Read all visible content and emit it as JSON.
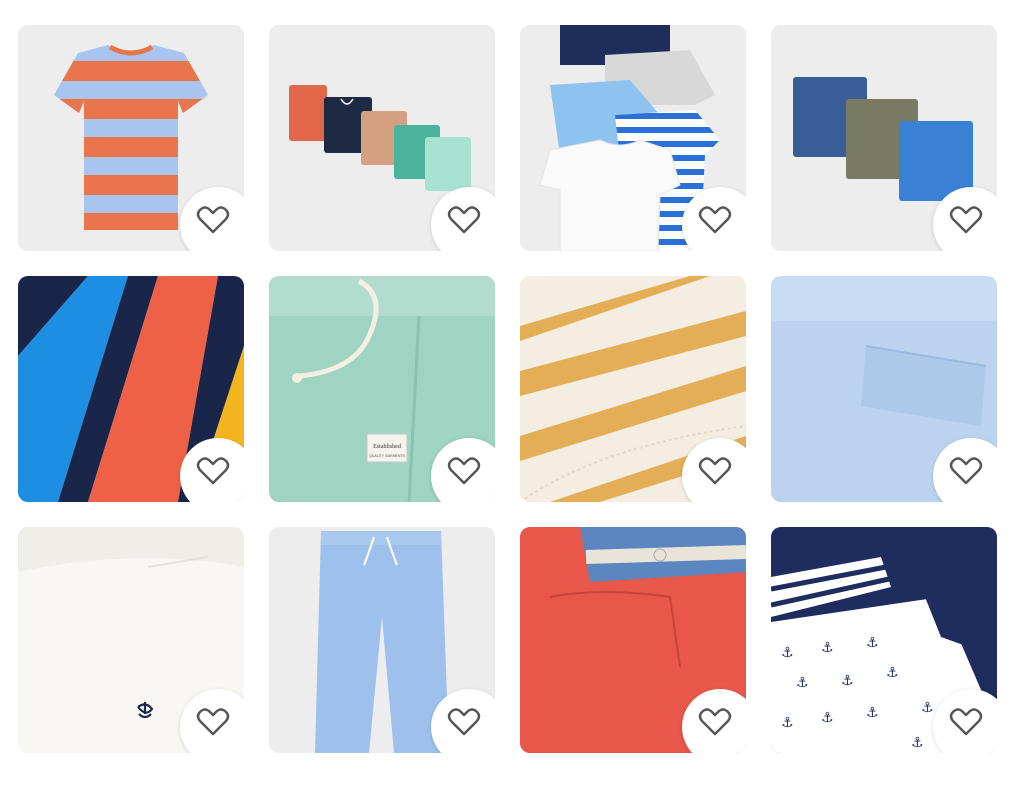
{
  "products": [
    {
      "name": "striped-tshirt",
      "icon": "heart-icon"
    },
    {
      "name": "five-pack-shorts",
      "icon": "heart-icon"
    },
    {
      "name": "five-pack-tshirts",
      "icon": "heart-icon"
    },
    {
      "name": "three-pack-chino-shorts",
      "icon": "heart-icon"
    },
    {
      "name": "colorblock-shorts-detail",
      "icon": "heart-icon"
    },
    {
      "name": "mint-linen-shorts-detail",
      "icon": "heart-icon",
      "tag_text": "Established",
      "tag_subtext": "QUALITY GARMENTS"
    },
    {
      "name": "yellow-stripe-fringe-detail",
      "icon": "heart-icon"
    },
    {
      "name": "light-blue-shorts-detail",
      "icon": "heart-icon"
    },
    {
      "name": "white-polo-detail",
      "icon": "heart-icon"
    },
    {
      "name": "light-blue-joggers",
      "icon": "heart-icon"
    },
    {
      "name": "red-shorts-waistband-detail",
      "icon": "heart-icon"
    },
    {
      "name": "navy-anchor-shorts-detail",
      "icon": "heart-icon"
    }
  ],
  "colors": {
    "card_bg": "#efefef",
    "fav_bg": "#ffffff",
    "fav_stroke": "#555555"
  }
}
